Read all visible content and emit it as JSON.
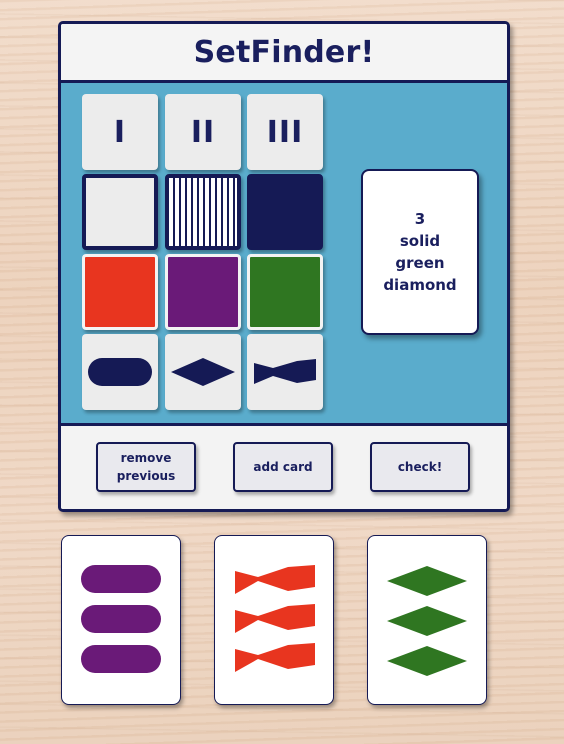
{
  "title": "SetFinder!",
  "selectors": {
    "numbers": [
      "I",
      "II",
      "III"
    ],
    "fills": [
      "empty",
      "striped",
      "solid"
    ],
    "colors": [
      "#e8351f",
      "#6a1a78",
      "#2f7621"
    ],
    "shapes": [
      "oval",
      "diamond",
      "wave"
    ]
  },
  "target_card": {
    "number": "3",
    "fill": "solid",
    "color": "green",
    "shape": "diamond"
  },
  "buttons": {
    "remove_line1": "remove",
    "remove_line2": "previous",
    "add": "add card",
    "check": "check!"
  },
  "hand": [
    {
      "count": 3,
      "shape": "oval",
      "color": "#6a1a78",
      "fill": "solid"
    },
    {
      "count": 3,
      "shape": "wave",
      "color": "#e8351f",
      "fill": "solid"
    },
    {
      "count": 3,
      "shape": "diamond",
      "color": "#2f7621",
      "fill": "solid"
    }
  ],
  "palette": {
    "navy": "#151a55",
    "board": "#5aaccc"
  }
}
